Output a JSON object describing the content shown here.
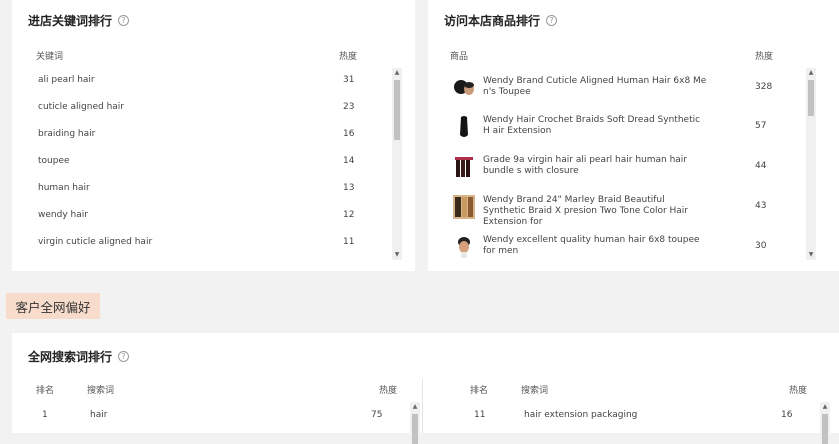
{
  "store_keywords": {
    "title": "进店关键词排行",
    "col_keyword": "关键词",
    "col_heat": "热度",
    "rows": [
      {
        "keyword": "ali pearl hair",
        "heat": "31"
      },
      {
        "keyword": "cuticle aligned hair",
        "heat": "23"
      },
      {
        "keyword": "braiding hair",
        "heat": "16"
      },
      {
        "keyword": "toupee",
        "heat": "14"
      },
      {
        "keyword": "human hair",
        "heat": "13"
      },
      {
        "keyword": "wendy hair",
        "heat": "12"
      },
      {
        "keyword": "virgin cuticle aligned hair",
        "heat": "11"
      }
    ]
  },
  "store_products": {
    "title": "访问本店商品排行",
    "col_product": "商品",
    "col_heat": "热度",
    "rows": [
      {
        "name": "Wendy Brand Cuticle Aligned Human Hair 6x8 Me n's Toupee",
        "heat": "328",
        "thumb": "toupee-thumbnail"
      },
      {
        "name": "Wendy Hair Crochet Braids Soft Dread Synthetic H air Extension",
        "heat": "57",
        "thumb": "braid-thumbnail"
      },
      {
        "name": "Grade 9a virgin hair ali pearl hair human hair bundle s with closure",
        "heat": "44",
        "thumb": "bundle-thumbnail"
      },
      {
        "name": "Wendy Brand 24\" Marley Braid Beautiful Synthetic Braid X presion Two Tone Color Hair Extension for",
        "heat": "43",
        "thumb": "marley-braid-thumbnail"
      },
      {
        "name": "Wendy excellent quality human hair 6x8 toupee for men",
        "heat": "30",
        "thumb": "toupee-men-thumbnail"
      }
    ]
  },
  "section_label": "客户全网偏好",
  "global_search": {
    "title": "全网搜索词排行",
    "left": {
      "col_rank": "排名",
      "col_term": "搜索词",
      "col_heat": "热度",
      "rows": [
        {
          "rank": "1",
          "term": "hair",
          "heat": "75"
        }
      ]
    },
    "right": {
      "col_rank": "排名",
      "col_term": "搜索词",
      "col_heat": "热度",
      "rows": [
        {
          "rank": "11",
          "term": "hair extension packaging",
          "heat": "16"
        }
      ]
    }
  },
  "icons": {
    "help": "?",
    "arrow_up": "▲",
    "arrow_down": "▼"
  }
}
